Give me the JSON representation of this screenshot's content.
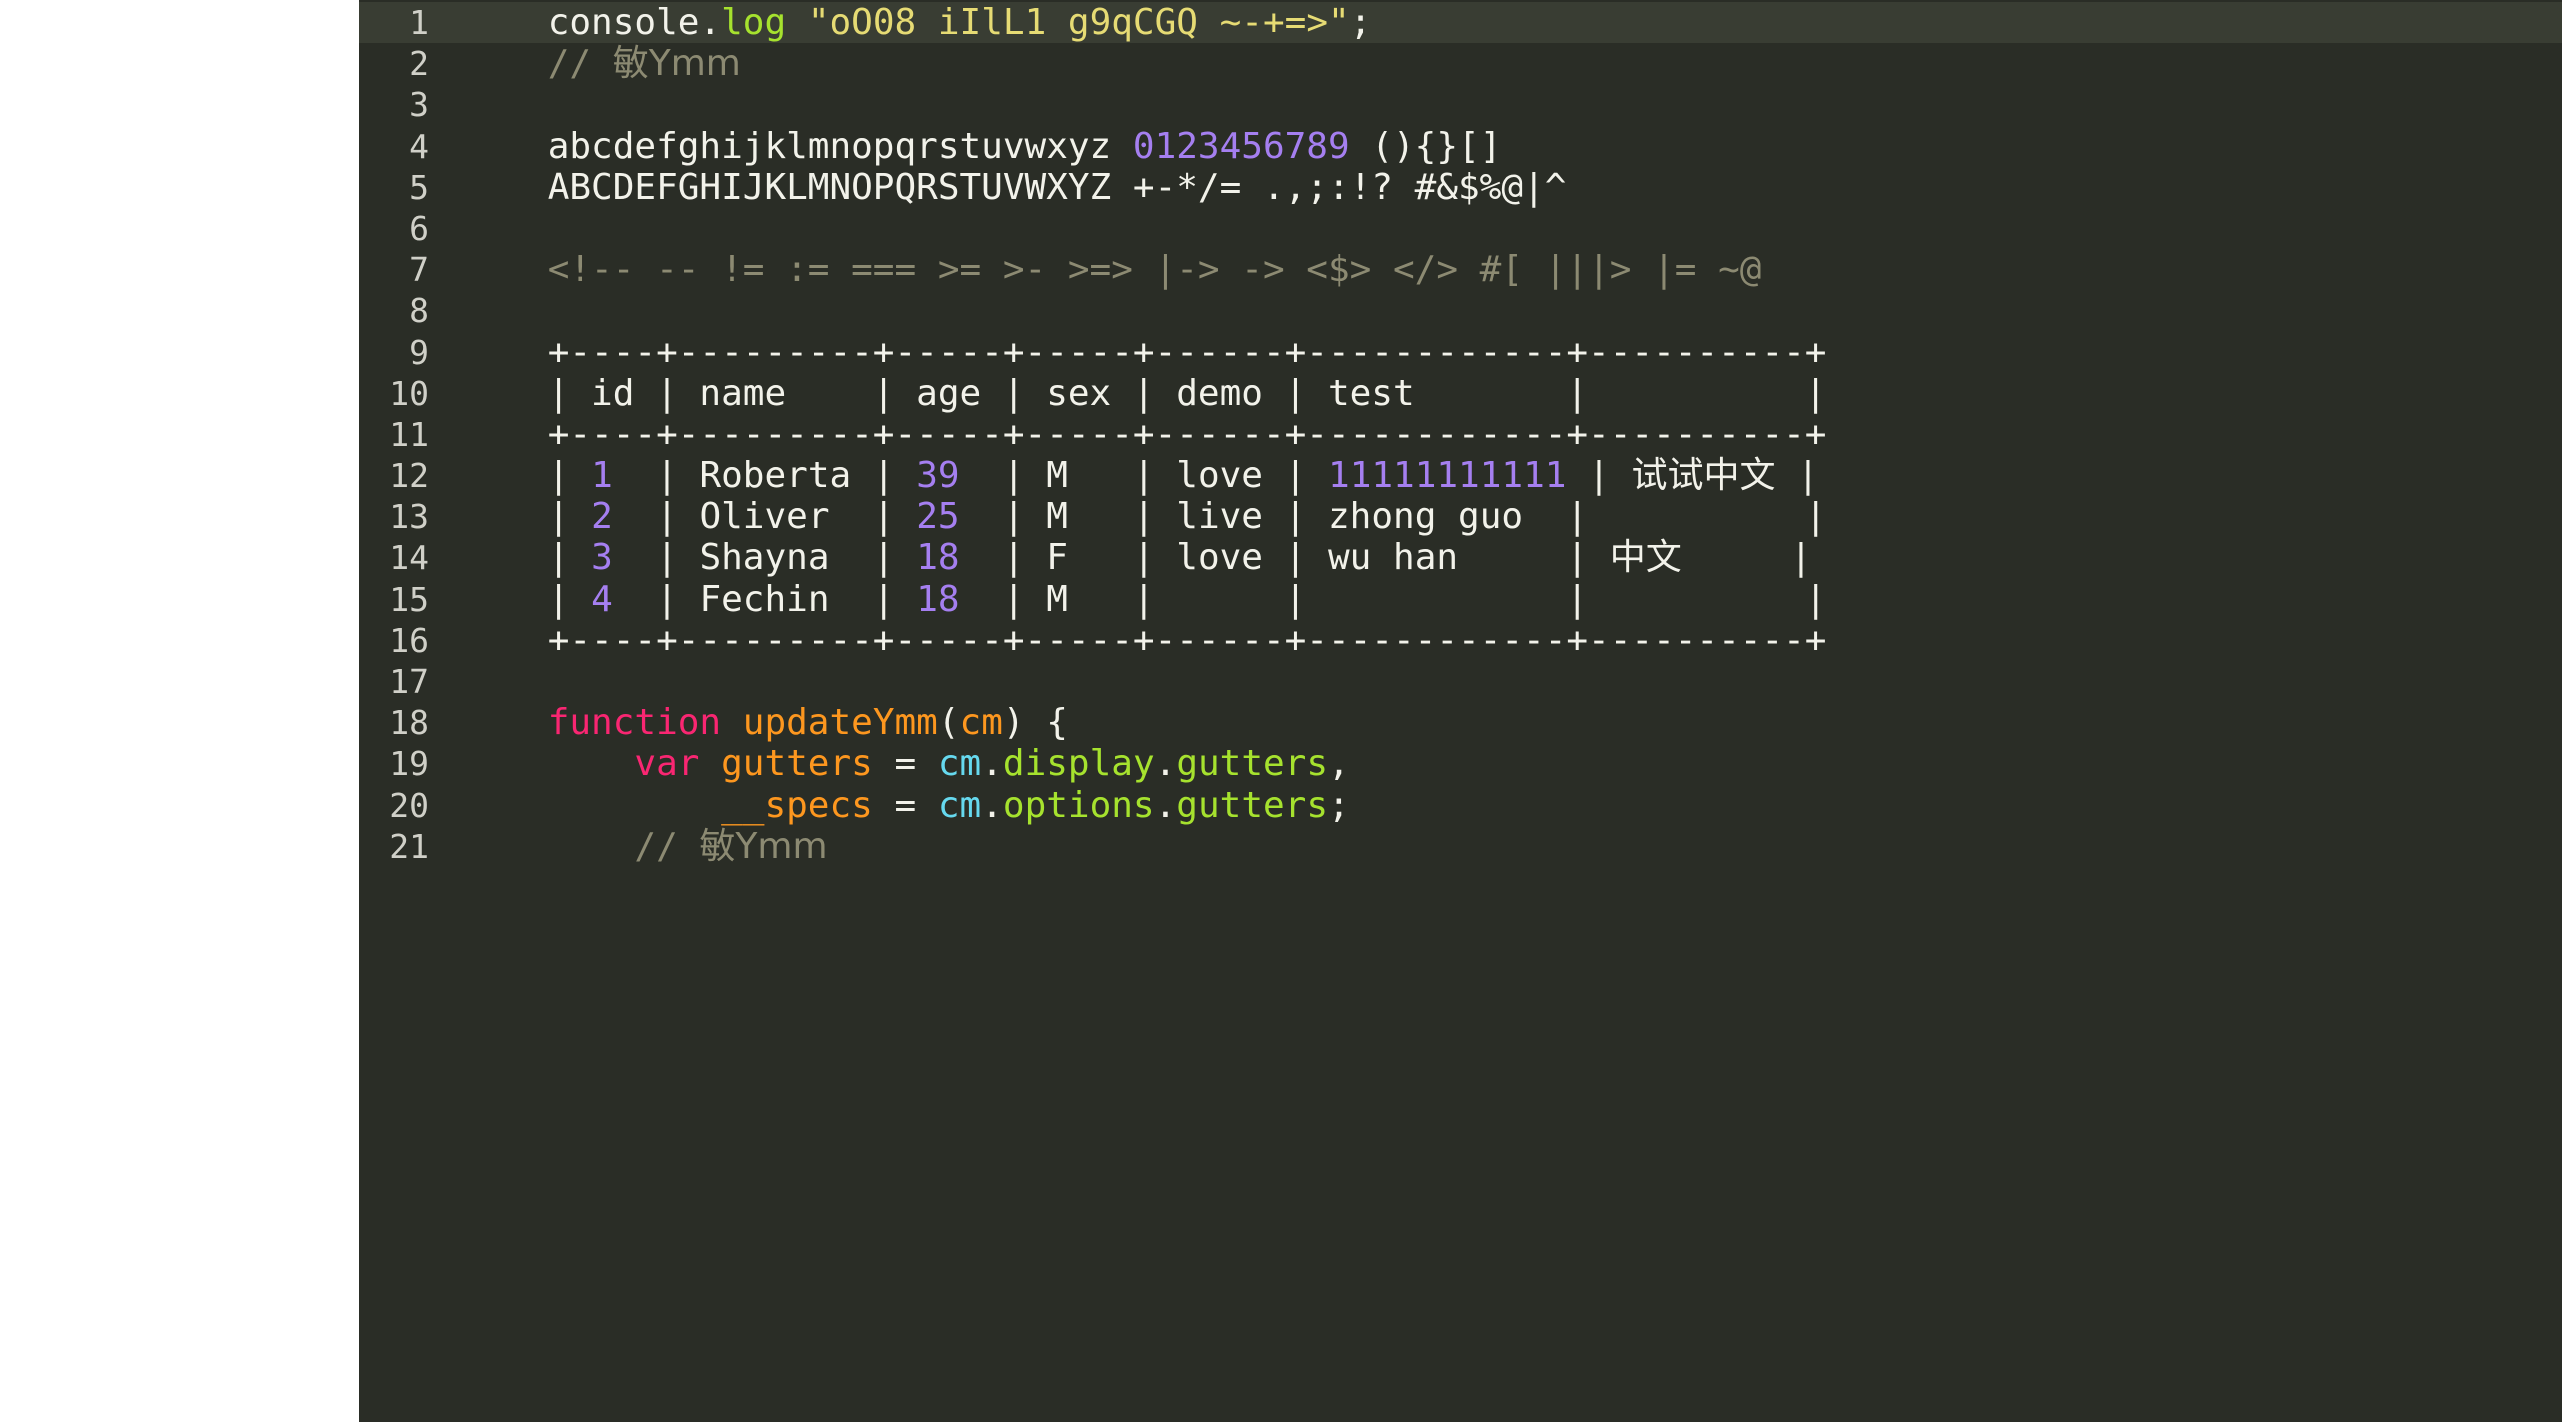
{
  "editor": {
    "theme_name": "monokai-dark",
    "colors": {
      "background": "#2a2d26",
      "active_line_background": "#393d33",
      "gutter_text": "#d0d0c8",
      "default_text": "#f2f2ea",
      "keyword": "#f92672",
      "function": "#a6e22e",
      "string": "#e6db74",
      "number": "#a57ff0",
      "comment": "#8c8a72",
      "variable": "#fd971f",
      "parameter_cyan": "#66d9ef",
      "property": "#a6e22e",
      "page_margin": "#ffffff"
    },
    "active_line": 1,
    "line_numbers": [
      "1",
      "2",
      "3",
      "4",
      "5",
      "6",
      "7",
      "8",
      "9",
      "10",
      "11",
      "12",
      "13",
      "14",
      "15",
      "16",
      "17",
      "18",
      "19",
      "20",
      "21"
    ],
    "lines": [
      {
        "number": "1",
        "active": true,
        "tokens": [
          {
            "text": "    ",
            "type": "plain"
          },
          {
            "text": "console",
            "type": "plain"
          },
          {
            "text": ".",
            "type": "punct"
          },
          {
            "text": "log",
            "type": "function"
          },
          {
            "text": " ",
            "type": "plain"
          },
          {
            "text": "\"oO08 iIlL1 g9qCGQ ~-+=>\"",
            "type": "string"
          },
          {
            "text": ";",
            "type": "punct"
          }
        ]
      },
      {
        "number": "2",
        "active": false,
        "tokens": [
          {
            "text": "    ",
            "type": "plain"
          },
          {
            "text": "// ",
            "type": "comment"
          },
          {
            "text": "敏Ymm",
            "type": "comment-cjk"
          }
        ]
      },
      {
        "number": "3",
        "active": false,
        "tokens": []
      },
      {
        "number": "4",
        "active": false,
        "tokens": [
          {
            "text": "    ",
            "type": "plain"
          },
          {
            "text": "abcdefghijklmnopqrstuvwxyz ",
            "type": "plain"
          },
          {
            "text": "0123456789",
            "type": "number"
          },
          {
            "text": " (){}[]",
            "type": "plain"
          }
        ]
      },
      {
        "number": "5",
        "active": false,
        "tokens": [
          {
            "text": "    ",
            "type": "plain"
          },
          {
            "text": "ABCDEFGHIJKLMNOPQRSTUVWXYZ +-*/= .,;:!? #&$%@|^",
            "type": "plain"
          }
        ]
      },
      {
        "number": "6",
        "active": false,
        "tokens": []
      },
      {
        "number": "7",
        "active": false,
        "tokens": [
          {
            "text": "    ",
            "type": "plain"
          },
          {
            "text": "<!-- -- != := === >= >- >=> |-> -> <$> </> #[ |||> |= ~@",
            "type": "operator"
          }
        ]
      },
      {
        "number": "8",
        "active": false,
        "tokens": []
      },
      {
        "number": "9",
        "active": false,
        "tokens": [
          {
            "text": "    ",
            "type": "plain"
          },
          {
            "text": "+----+---------+-----+-----+------+------------+----------+",
            "type": "plain"
          }
        ]
      },
      {
        "number": "10",
        "active": false,
        "tokens": [
          {
            "text": "    ",
            "type": "plain"
          },
          {
            "text": "| id | name    | age | sex | demo | test       |          |",
            "type": "plain"
          }
        ]
      },
      {
        "number": "11",
        "active": false,
        "tokens": [
          {
            "text": "    ",
            "type": "plain"
          },
          {
            "text": "+----+---------+-----+-----+------+------------+----------+",
            "type": "plain"
          }
        ]
      },
      {
        "number": "12",
        "active": false,
        "tokens": [
          {
            "text": "    ",
            "type": "plain"
          },
          {
            "text": "| ",
            "type": "plain"
          },
          {
            "text": "1",
            "type": "number"
          },
          {
            "text": "  | Roberta | ",
            "type": "plain"
          },
          {
            "text": "39",
            "type": "number"
          },
          {
            "text": "  | M   | love | ",
            "type": "plain"
          },
          {
            "text": "11111111111",
            "type": "number"
          },
          {
            "text": " | ",
            "type": "plain"
          },
          {
            "text": "试试中文",
            "type": "plain-cjk"
          },
          {
            "text": " |",
            "type": "plain"
          }
        ]
      },
      {
        "number": "13",
        "active": false,
        "tokens": [
          {
            "text": "    ",
            "type": "plain"
          },
          {
            "text": "| ",
            "type": "plain"
          },
          {
            "text": "2",
            "type": "number"
          },
          {
            "text": "  | Oliver  | ",
            "type": "plain"
          },
          {
            "text": "25",
            "type": "number"
          },
          {
            "text": "  | M   | live | zhong guo  |          |",
            "type": "plain"
          }
        ]
      },
      {
        "number": "14",
        "active": false,
        "tokens": [
          {
            "text": "    ",
            "type": "plain"
          },
          {
            "text": "| ",
            "type": "plain"
          },
          {
            "text": "3",
            "type": "number"
          },
          {
            "text": "  | Shayna  | ",
            "type": "plain"
          },
          {
            "text": "18",
            "type": "number"
          },
          {
            "text": "  | F   | love | wu han     | ",
            "type": "plain"
          },
          {
            "text": "中文",
            "type": "plain-cjk"
          },
          {
            "text": "     |",
            "type": "plain"
          }
        ]
      },
      {
        "number": "15",
        "active": false,
        "tokens": [
          {
            "text": "    ",
            "type": "plain"
          },
          {
            "text": "| ",
            "type": "plain"
          },
          {
            "text": "4",
            "type": "number"
          },
          {
            "text": "  | Fechin  | ",
            "type": "plain"
          },
          {
            "text": "18",
            "type": "number"
          },
          {
            "text": "  | M   |      |            |          |",
            "type": "plain"
          }
        ]
      },
      {
        "number": "16",
        "active": false,
        "tokens": [
          {
            "text": "    ",
            "type": "plain"
          },
          {
            "text": "+----+---------+-----+-----+------+------------+----------+",
            "type": "plain"
          }
        ]
      },
      {
        "number": "17",
        "active": false,
        "tokens": []
      },
      {
        "number": "18",
        "active": false,
        "tokens": [
          {
            "text": "    ",
            "type": "plain"
          },
          {
            "text": "function",
            "type": "keyword"
          },
          {
            "text": " ",
            "type": "plain"
          },
          {
            "text": "updateYmm",
            "type": "variable"
          },
          {
            "text": "(",
            "type": "punct"
          },
          {
            "text": "cm",
            "type": "variable"
          },
          {
            "text": ") {",
            "type": "punct"
          }
        ]
      },
      {
        "number": "19",
        "active": false,
        "tokens": [
          {
            "text": "        ",
            "type": "plain"
          },
          {
            "text": "var",
            "type": "keyword"
          },
          {
            "text": " ",
            "type": "plain"
          },
          {
            "text": "gutters",
            "type": "variable"
          },
          {
            "text": " = ",
            "type": "punct"
          },
          {
            "text": "cm",
            "type": "parameter-cyan"
          },
          {
            "text": ".",
            "type": "punct"
          },
          {
            "text": "display",
            "type": "property"
          },
          {
            "text": ".",
            "type": "punct"
          },
          {
            "text": "gutters",
            "type": "property"
          },
          {
            "text": ",",
            "type": "punct"
          }
        ]
      },
      {
        "number": "20",
        "active": false,
        "tokens": [
          {
            "text": "            ",
            "type": "plain"
          },
          {
            "text": "__specs",
            "type": "variable"
          },
          {
            "text": " = ",
            "type": "punct"
          },
          {
            "text": "cm",
            "type": "parameter-cyan"
          },
          {
            "text": ".",
            "type": "punct"
          },
          {
            "text": "options",
            "type": "property"
          },
          {
            "text": ".",
            "type": "punct"
          },
          {
            "text": "gutters",
            "type": "property"
          },
          {
            "text": ";",
            "type": "punct"
          }
        ]
      },
      {
        "number": "21",
        "active": false,
        "tokens": [
          {
            "text": "        ",
            "type": "plain"
          },
          {
            "text": "// ",
            "type": "comment"
          },
          {
            "text": "敏Ymm",
            "type": "comment-cjk"
          }
        ]
      }
    ]
  }
}
